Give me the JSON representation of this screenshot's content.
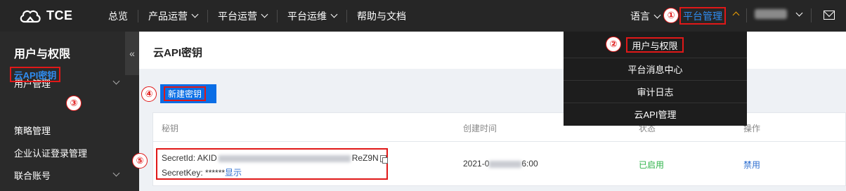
{
  "topbar": {
    "logo_text": "TCE",
    "nav": [
      {
        "label": "总览",
        "dropdown": false
      },
      {
        "label": "产品运营",
        "dropdown": true
      },
      {
        "label": "平台运营",
        "dropdown": true
      },
      {
        "label": "平台运维",
        "dropdown": true
      },
      {
        "label": "帮助与文档",
        "dropdown": false
      }
    ],
    "language_label": "语言",
    "platform_manage_label": "平台管理"
  },
  "sidebar": {
    "title": "用户与权限",
    "items": [
      {
        "label": "用户管理",
        "expandable": true
      },
      {
        "label": "云API密钥",
        "active": true
      },
      {
        "label": "策略管理"
      },
      {
        "label": "企业认证登录管理"
      },
      {
        "label": "联合账号",
        "expandable": true
      }
    ],
    "collapse_glyph": "«"
  },
  "main": {
    "page_title": "云API密钥",
    "new_key_button": "新建密钥",
    "table": {
      "headers": [
        "秘钥",
        "创建时间",
        "状态",
        "操作"
      ],
      "rows": [
        {
          "secret_id_prefix": "SecretId: AKID",
          "secret_id_suffix": "ReZ9N",
          "secret_key_label": "SecretKey: ******",
          "show_link": "显示",
          "created_prefix": "2021-0",
          "created_suffix": "6:00",
          "status": "已启用",
          "action": "禁用"
        }
      ]
    }
  },
  "dropdown": {
    "items": [
      "用户与权限",
      "平台消息中心",
      "审计日志",
      "云API管理"
    ]
  },
  "callouts": [
    "①",
    "②",
    "③",
    "④",
    "⑤"
  ],
  "colors": {
    "highlight": "#e01818",
    "link": "#2f8cf0",
    "status_enabled": "#2fb34a",
    "primary_button": "#0a6ee6"
  }
}
